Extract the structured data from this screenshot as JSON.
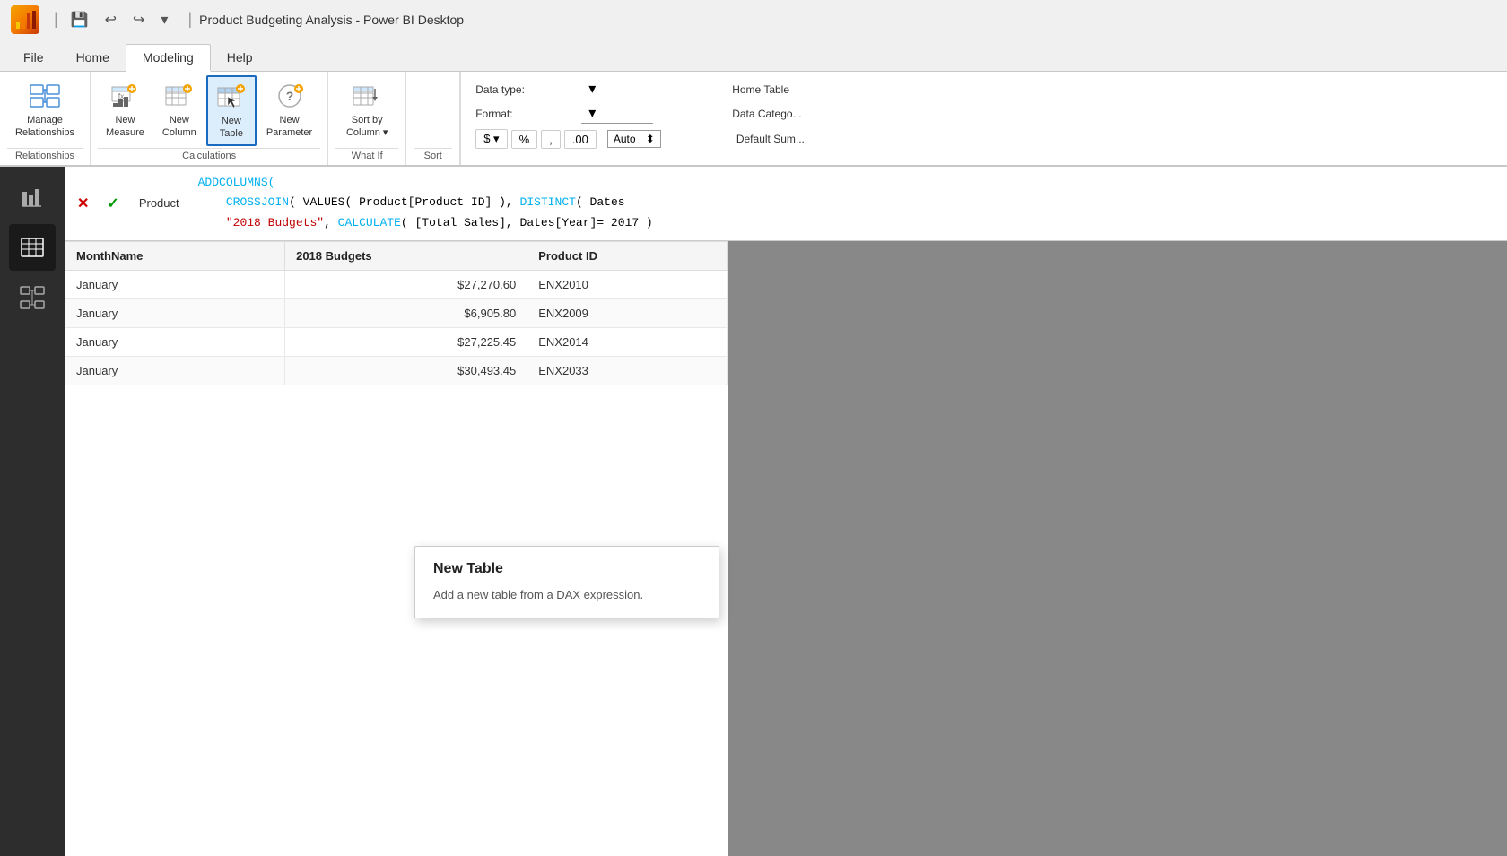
{
  "titleBar": {
    "logo": "PB",
    "title": "Product Budgeting Analysis - Power BI Desktop",
    "controls": [
      "save",
      "undo",
      "redo",
      "dropdown"
    ]
  },
  "ribbonTabs": [
    {
      "id": "file",
      "label": "File"
    },
    {
      "id": "home",
      "label": "Home"
    },
    {
      "id": "modeling",
      "label": "Modeling",
      "active": true
    },
    {
      "id": "help",
      "label": "Help"
    }
  ],
  "ribbon": {
    "groups": [
      {
        "id": "relationships",
        "label": "Relationships",
        "buttons": [
          {
            "id": "manage-relationships",
            "lines": [
              "Manage",
              "Relationships"
            ]
          }
        ]
      },
      {
        "id": "calculations",
        "label": "Calculations",
        "buttons": [
          {
            "id": "new-measure",
            "lines": [
              "New",
              "Measure"
            ]
          },
          {
            "id": "new-column",
            "lines": [
              "New",
              "Column"
            ]
          },
          {
            "id": "new-table",
            "lines": [
              "New",
              "Table"
            ],
            "active": true
          },
          {
            "id": "new-parameter",
            "lines": [
              "New",
              "Parameter"
            ]
          }
        ]
      },
      {
        "id": "whatif",
        "label": "What If",
        "buttons": [
          {
            "id": "sort-by-column",
            "lines": [
              "Sort by",
              "Column"
            ]
          }
        ]
      },
      {
        "id": "sort",
        "label": "Sort"
      }
    ],
    "properties": {
      "dataType": {
        "label": "Data type:",
        "value": ""
      },
      "format": {
        "label": "Format:",
        "value": ""
      },
      "homeTable": {
        "label": "Home Table"
      },
      "dataCategory": {
        "label": "Data Catego..."
      },
      "defaultSum": {
        "label": "Default Sum..."
      },
      "formatButtons": [
        "$",
        "%",
        ",",
        ".00"
      ],
      "autoLabel": "Auto"
    }
  },
  "sidebar": {
    "icons": [
      {
        "id": "report",
        "symbol": "📊"
      },
      {
        "id": "data",
        "symbol": "⊞",
        "active": true
      },
      {
        "id": "relationships",
        "symbol": "⧉"
      }
    ]
  },
  "formulaBar": {
    "tableName": "Product",
    "lines": [
      "ADDCOLUMNS(",
      "    CROSSJOIN( VALUES( Product[Product ID] ), DISTINCT( Dates",
      "    \"2018 Budgets\",  CALCULATE( [Total Sales], Dates[Year]= 2017 )"
    ]
  },
  "table": {
    "columns": [
      "MonthName",
      "2018 Budgets",
      "Product ID"
    ],
    "rows": [
      {
        "MonthName": "January",
        "2018 Budgets": "$27,270.60",
        "ProductID": "ENX2010"
      },
      {
        "MonthName": "January",
        "2018 Budgets": "$6,905.80",
        "ProductID": "ENX2009"
      },
      {
        "MonthName": "January",
        "2018 Budgets": "$27,225.45",
        "ProductID": "ENX2014"
      },
      {
        "MonthName": "January",
        "2018 Budgets": "$30,493.45",
        "ProductID": "ENX2033"
      }
    ]
  },
  "tooltip": {
    "title": "New Table",
    "body": "Add a new table from a DAX expression."
  },
  "buttons": {
    "cancel": "✕",
    "confirm": "✓"
  }
}
